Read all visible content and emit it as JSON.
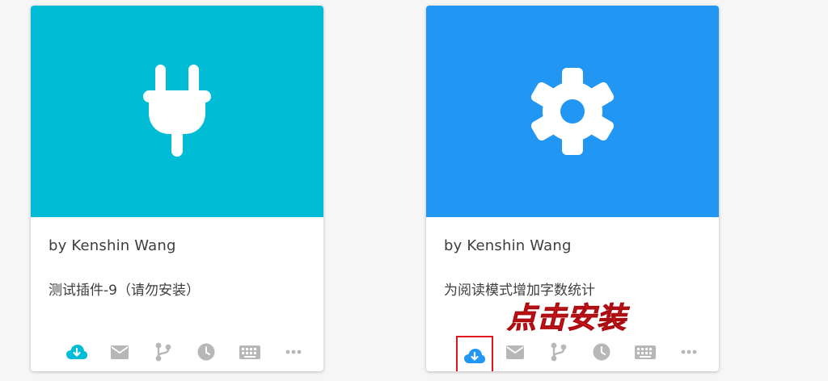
{
  "colors": {
    "banner_teal": "#00bcd4",
    "banner_blue": "#2196f3",
    "icon_grey": "#b7b7b7",
    "highlight_red": "#e0161c"
  },
  "cards": [
    {
      "banner_icon": "plug-icon",
      "author": "by Kenshin Wang",
      "description": "测试插件-9（请勿安装）"
    },
    {
      "banner_icon": "gear-icon",
      "author": "by Kenshin Wang",
      "description": "为阅读模式增加字数统计"
    }
  ],
  "actions": [
    "cloud-download-icon",
    "mail-icon",
    "git-branch-icon",
    "clock-icon",
    "keyboard-icon",
    "more-dots-icon"
  ],
  "overlay": {
    "label": "点击安装"
  }
}
